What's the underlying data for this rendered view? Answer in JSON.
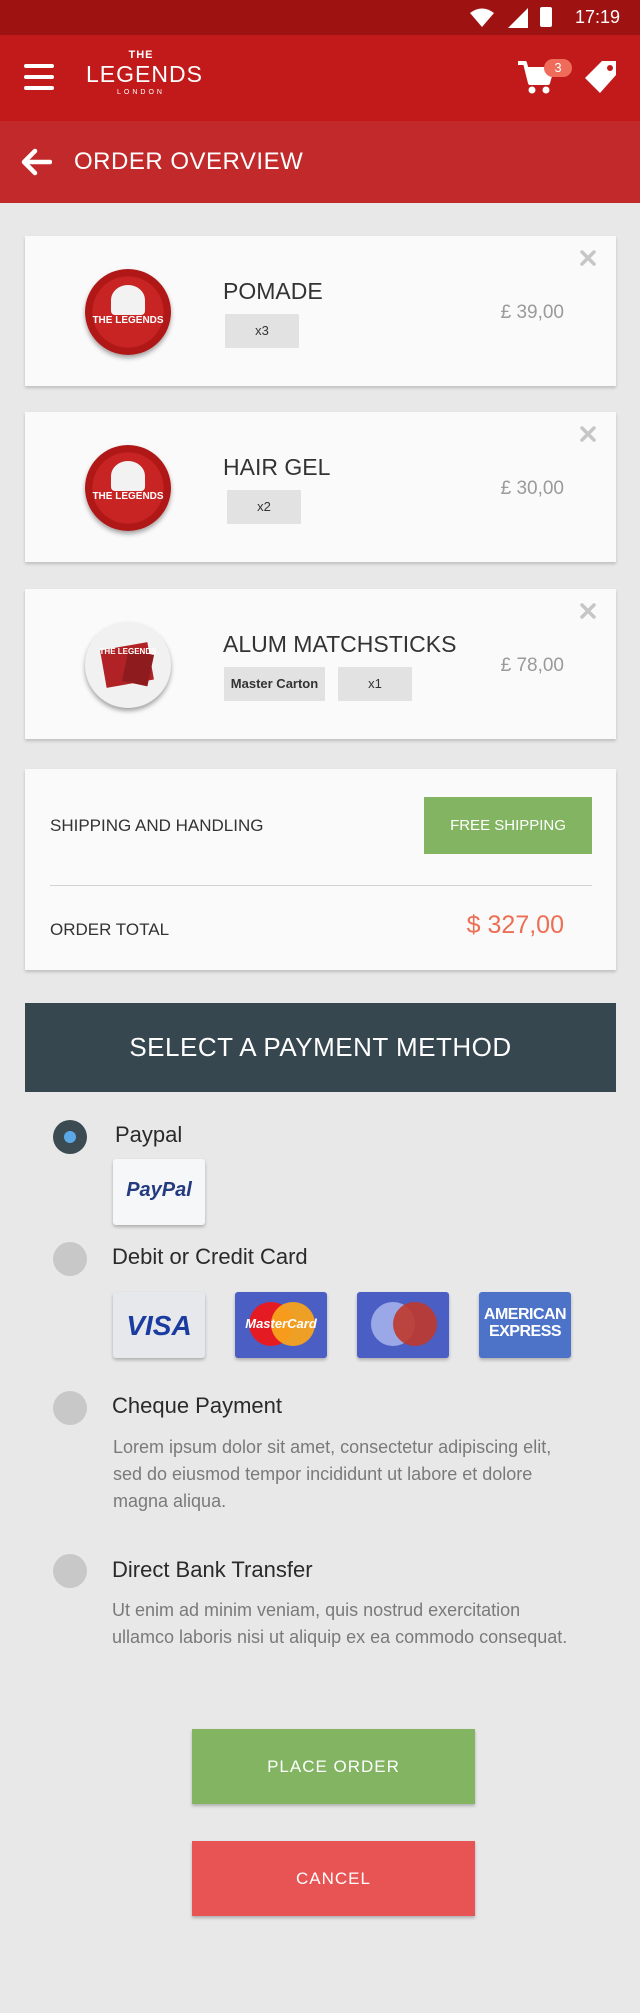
{
  "status_bar": {
    "time": "17:19"
  },
  "app_bar": {
    "logo": {
      "the": "THE",
      "name": "LEGENDS",
      "city": "LONDON"
    },
    "cart_count": "3"
  },
  "sub_bar": {
    "title": "ORDER OVERVIEW"
  },
  "products": [
    {
      "name": "POMADE",
      "chips": [
        "x3"
      ],
      "price": "£ 39,00",
      "tin_label": "THE LEGENDS"
    },
    {
      "name": "HAIR GEL",
      "chips": [
        "x2"
      ],
      "price": "£ 30,00",
      "tin_label": "THE LEGENDS"
    },
    {
      "name": "ALUM MATCHSTICKS",
      "chips": [
        "Master Carton",
        "x1"
      ],
      "price": "£ 78,00",
      "tin_label": "THE LEGENDS"
    }
  ],
  "summary": {
    "shipping_label": "SHIPPING AND HANDLING",
    "shipping_button": "FREE SHIPPING",
    "total_label": "ORDER TOTAL",
    "total_value": "$ 327,00"
  },
  "payment": {
    "header": "SELECT A PAYMENT METHOD",
    "options": [
      {
        "label": "Paypal",
        "selected": true
      },
      {
        "label": "Debit or Credit Card",
        "selected": false
      },
      {
        "label": "Cheque Payment",
        "selected": false,
        "description": "Lorem ipsum dolor sit amet, consectetur adipiscing elit, sed do eiusmod tempor incididunt ut labore et dolore magna aliqua."
      },
      {
        "label": "Direct Bank Transfer",
        "selected": false,
        "description": "Ut enim ad minim veniam, quis nostrud exercitation ullamco laboris nisi ut aliquip ex ea commodo consequat."
      }
    ],
    "logos": {
      "paypal": "PayPal",
      "visa": "VISA",
      "mastercard": "MasterCard",
      "amex": "AMERICAN EXPRESS"
    }
  },
  "buttons": {
    "place_order": "PLACE ORDER",
    "cancel": "CANCEL"
  },
  "colors": {
    "primary_red": "#c21a1a",
    "green": "#82b462",
    "cancel_red": "#e85454",
    "dark_header": "#37474f",
    "total_orange": "#ec6f55"
  }
}
